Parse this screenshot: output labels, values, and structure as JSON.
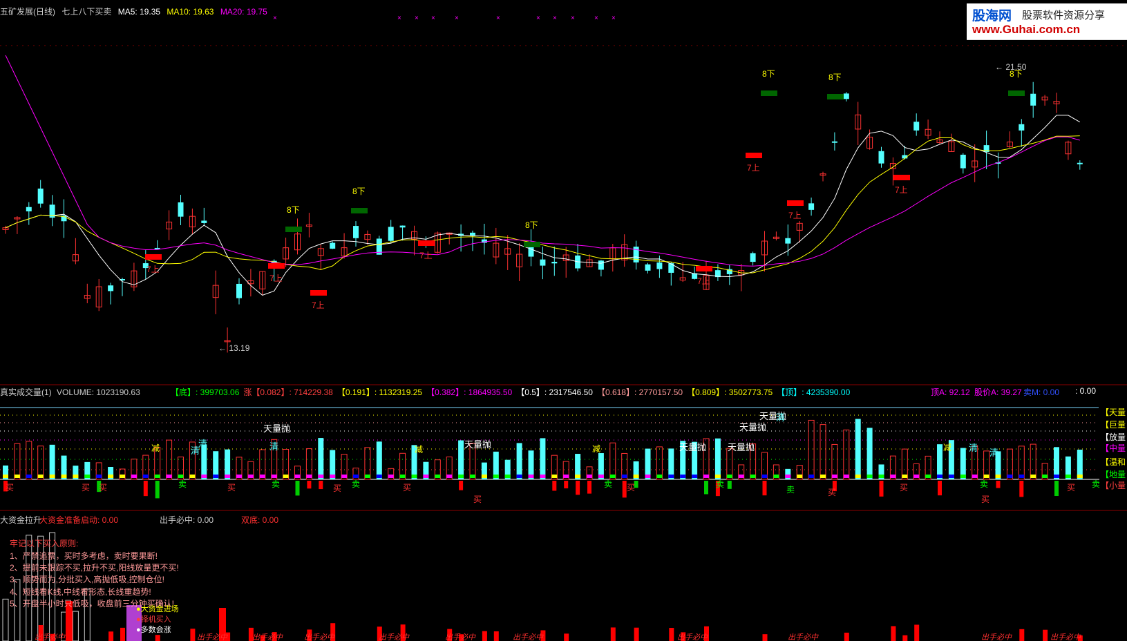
{
  "header": {
    "title_stock": "五矿发展(日线)",
    "indicator_name": "七上八下买卖",
    "ma5_label": "MA5: 19.35",
    "ma10_label": "MA10: 19.63",
    "ma20_label": "MA20: 19.75"
  },
  "logo": {
    "brand": "股海网",
    "tagline": "股票软件资源分享",
    "url": "www.Guhai.com.cn"
  },
  "price_panel": {
    "high_marker": "21.50",
    "low_marker": "13.19",
    "signal_up": "7上",
    "signal_down": "8下"
  },
  "volume_header": {
    "name": "真实成交量(1)",
    "volume": "VOLUME: 1023190.63",
    "levels": [
      {
        "label": "【底】",
        "value": ": 399703.06",
        "color": "#00ff00"
      },
      {
        "label": "涨【0.082】",
        "value": ": 714229.38",
        "color": "#ff4040"
      },
      {
        "label": "【0.191】",
        "value": ": 1132319.25",
        "color": "#ffff00"
      },
      {
        "label": "【0.382】",
        "value": ": 1864935.50",
        "color": "#ff00ff"
      },
      {
        "label": "【0.5】",
        "value": ": 2317546.50",
        "color": "#ffffff"
      },
      {
        "label": "【0.618】",
        "value": ": 2770157.50",
        "color": "#ff9a9a"
      },
      {
        "label": "【0.809】",
        "value": ": 3502773.75",
        "color": "#ffff00"
      },
      {
        "label": "【顶】",
        "value": ": 4235390.00",
        "color": "#00ffff"
      }
    ],
    "top_a": "顶A: 92.12",
    "price_a": "股价A: 39.27",
    "sell_m": "卖M: 0.00",
    "end_val": ": 0.00"
  },
  "volume_panel": {
    "right_tags": [
      {
        "text": "【天量",
        "color": "#ffff00"
      },
      {
        "text": "【巨量",
        "color": "#ffff00"
      },
      {
        "text": "【放量",
        "color": "#ffffff"
      },
      {
        "text": "【中量",
        "color": "#ff00ff"
      },
      {
        "text": "【温和",
        "color": "#ffff00"
      },
      {
        "text": "【地量",
        "color": "#00ff00"
      },
      {
        "text": "【小量",
        "color": "#ff4040"
      }
    ],
    "tian_liang_pao": "天量抛",
    "qing": "清",
    "jian": "减",
    "mai_buy": "买",
    "mai_sell": "卖"
  },
  "bottom_header": {
    "name": "大资金拉升",
    "big_fund_start": "大资金准备启动: 0.00",
    "must_hit": "出手必中: 0.00",
    "double_bottom": "双底: 0.00"
  },
  "rules": {
    "title": "牢记以下买入原则:",
    "items": [
      "1、严禁追票，买时多考虑，卖时要果断!",
      "2、提前未跟踪不买,拉升不买,阳线放量更不买!",
      "3、顺势而为,分批买入,高抛低吸,控制仓位!",
      "4、短线看K线,中线看形态,长线重趋势!",
      "5、开盘半小时只低吸，收盘前三分钟买确认!"
    ]
  },
  "legend": {
    "items": [
      {
        "text": "大资金进场",
        "color": "#ffff00"
      },
      {
        "text": "择机买入",
        "color": "#ff4040"
      },
      {
        "text": "多数会涨",
        "color": "#ffffff"
      }
    ]
  },
  "bottom_signal": "出手必中",
  "colors": {
    "up": "#ff3232",
    "down": "#54ffff",
    "ma5": "#ffffff",
    "ma10": "#ffff00",
    "ma20": "#ff00ff",
    "buy_box": "#ff0000",
    "sell_box": "#006600"
  }
}
